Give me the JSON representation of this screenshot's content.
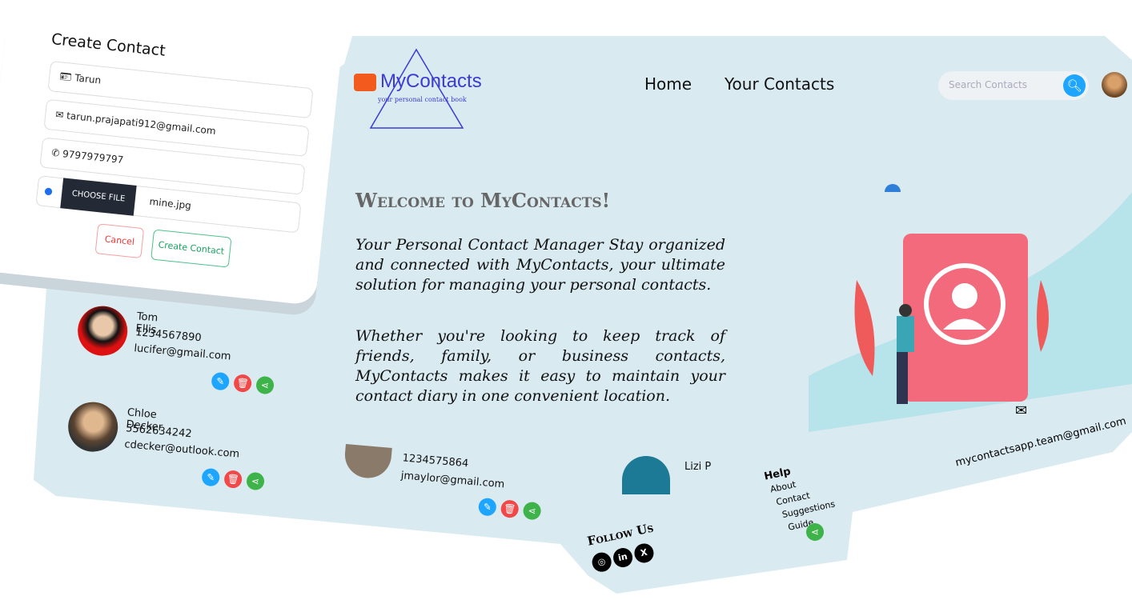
{
  "header": {
    "logo": "MyContacts",
    "tagline": "your personal contact book",
    "nav": [
      "Home",
      "Your Contacts"
    ],
    "search_placeholder": "Search Contacts"
  },
  "hero": {
    "welcome": "Welcome to MyContacts!",
    "para1": "Your Personal Contact Manager Stay organized and connected with MyContacts, your ultimate solution for managing your personal contacts.",
    "para2": "Whether you're looking to keep track of friends, family, or business contacts, MyContacts makes it easy to maintain your contact diary in one convenient location."
  },
  "form": {
    "title": "Create Contact",
    "name": "Tarun",
    "email": "tarun.prajapati912@gmail.com",
    "phone": "9797979797",
    "choose_file": "CHOOSE FILE",
    "file": "mine.jpg",
    "cancel": "Cancel",
    "submit": "Create Contact"
  },
  "contacts": [
    {
      "name": "Tom Ellis",
      "phone": "1234567890",
      "email": "lucifer@gmail.com"
    },
    {
      "name": "Chloe Decker",
      "phone": "5562634242",
      "email": "cdecker@outlook.com"
    },
    {
      "phone": "1234575864",
      "email": "jmaylor@gmail.com"
    },
    {
      "name": "Lizi P"
    }
  ],
  "footer": {
    "follow": "Follow Us",
    "help": "Help",
    "links": [
      "About",
      "Contact",
      "Suggestions",
      "Guide"
    ],
    "email": "mycontactsapp.team@gmail.com"
  },
  "colors": {
    "background": "#d9eaf1",
    "accent": "#1ea5ff",
    "delete": "#f24848",
    "share": "#3db34a",
    "logo": "#3b3bd6"
  }
}
